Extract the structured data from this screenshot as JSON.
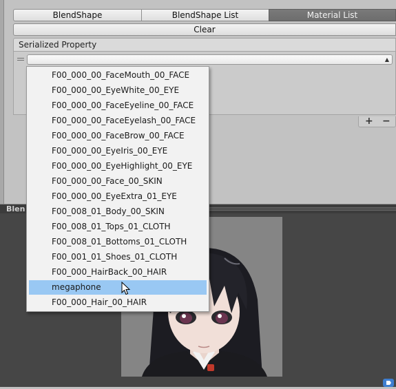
{
  "tabs": [
    {
      "label": "BlendShape",
      "active": false
    },
    {
      "label": "BlendShape List",
      "active": false
    },
    {
      "label": "Material List",
      "active": true
    }
  ],
  "clear_button": {
    "label": "Clear"
  },
  "serialized_property": {
    "header": "Serialized Property",
    "dropdown_value": ""
  },
  "list_footer": {
    "add_label": "+",
    "remove_label": "−"
  },
  "preview": {
    "title": "Blen"
  },
  "popup": {
    "items": [
      "F00_000_00_FaceMouth_00_FACE",
      "F00_000_00_EyeWhite_00_EYE",
      "F00_000_00_FaceEyeline_00_FACE",
      "F00_000_00_FaceEyelash_00_FACE",
      "F00_000_00_FaceBrow_00_FACE",
      "F00_000_00_EyeIris_00_EYE",
      "F00_000_00_EyeHighlight_00_EYE",
      "F00_000_00_Face_00_SKIN",
      "F00_000_00_EyeExtra_01_EYE",
      "F00_008_01_Body_00_SKIN",
      "F00_008_01_Tops_01_CLOTH",
      "F00_008_01_Bottoms_01_CLOTH",
      "F00_001_01_Shoes_01_CLOTH",
      "F00_000_HairBack_00_HAIR",
      "megaphone",
      "F00_000_Hair_00_HAIR"
    ],
    "selected_index": 14
  },
  "colors": {
    "panel_bg": "#c2c2c2",
    "active_tab": "#6d6d6d",
    "selection": "#99c8f3",
    "preview_bg": "#464646"
  }
}
